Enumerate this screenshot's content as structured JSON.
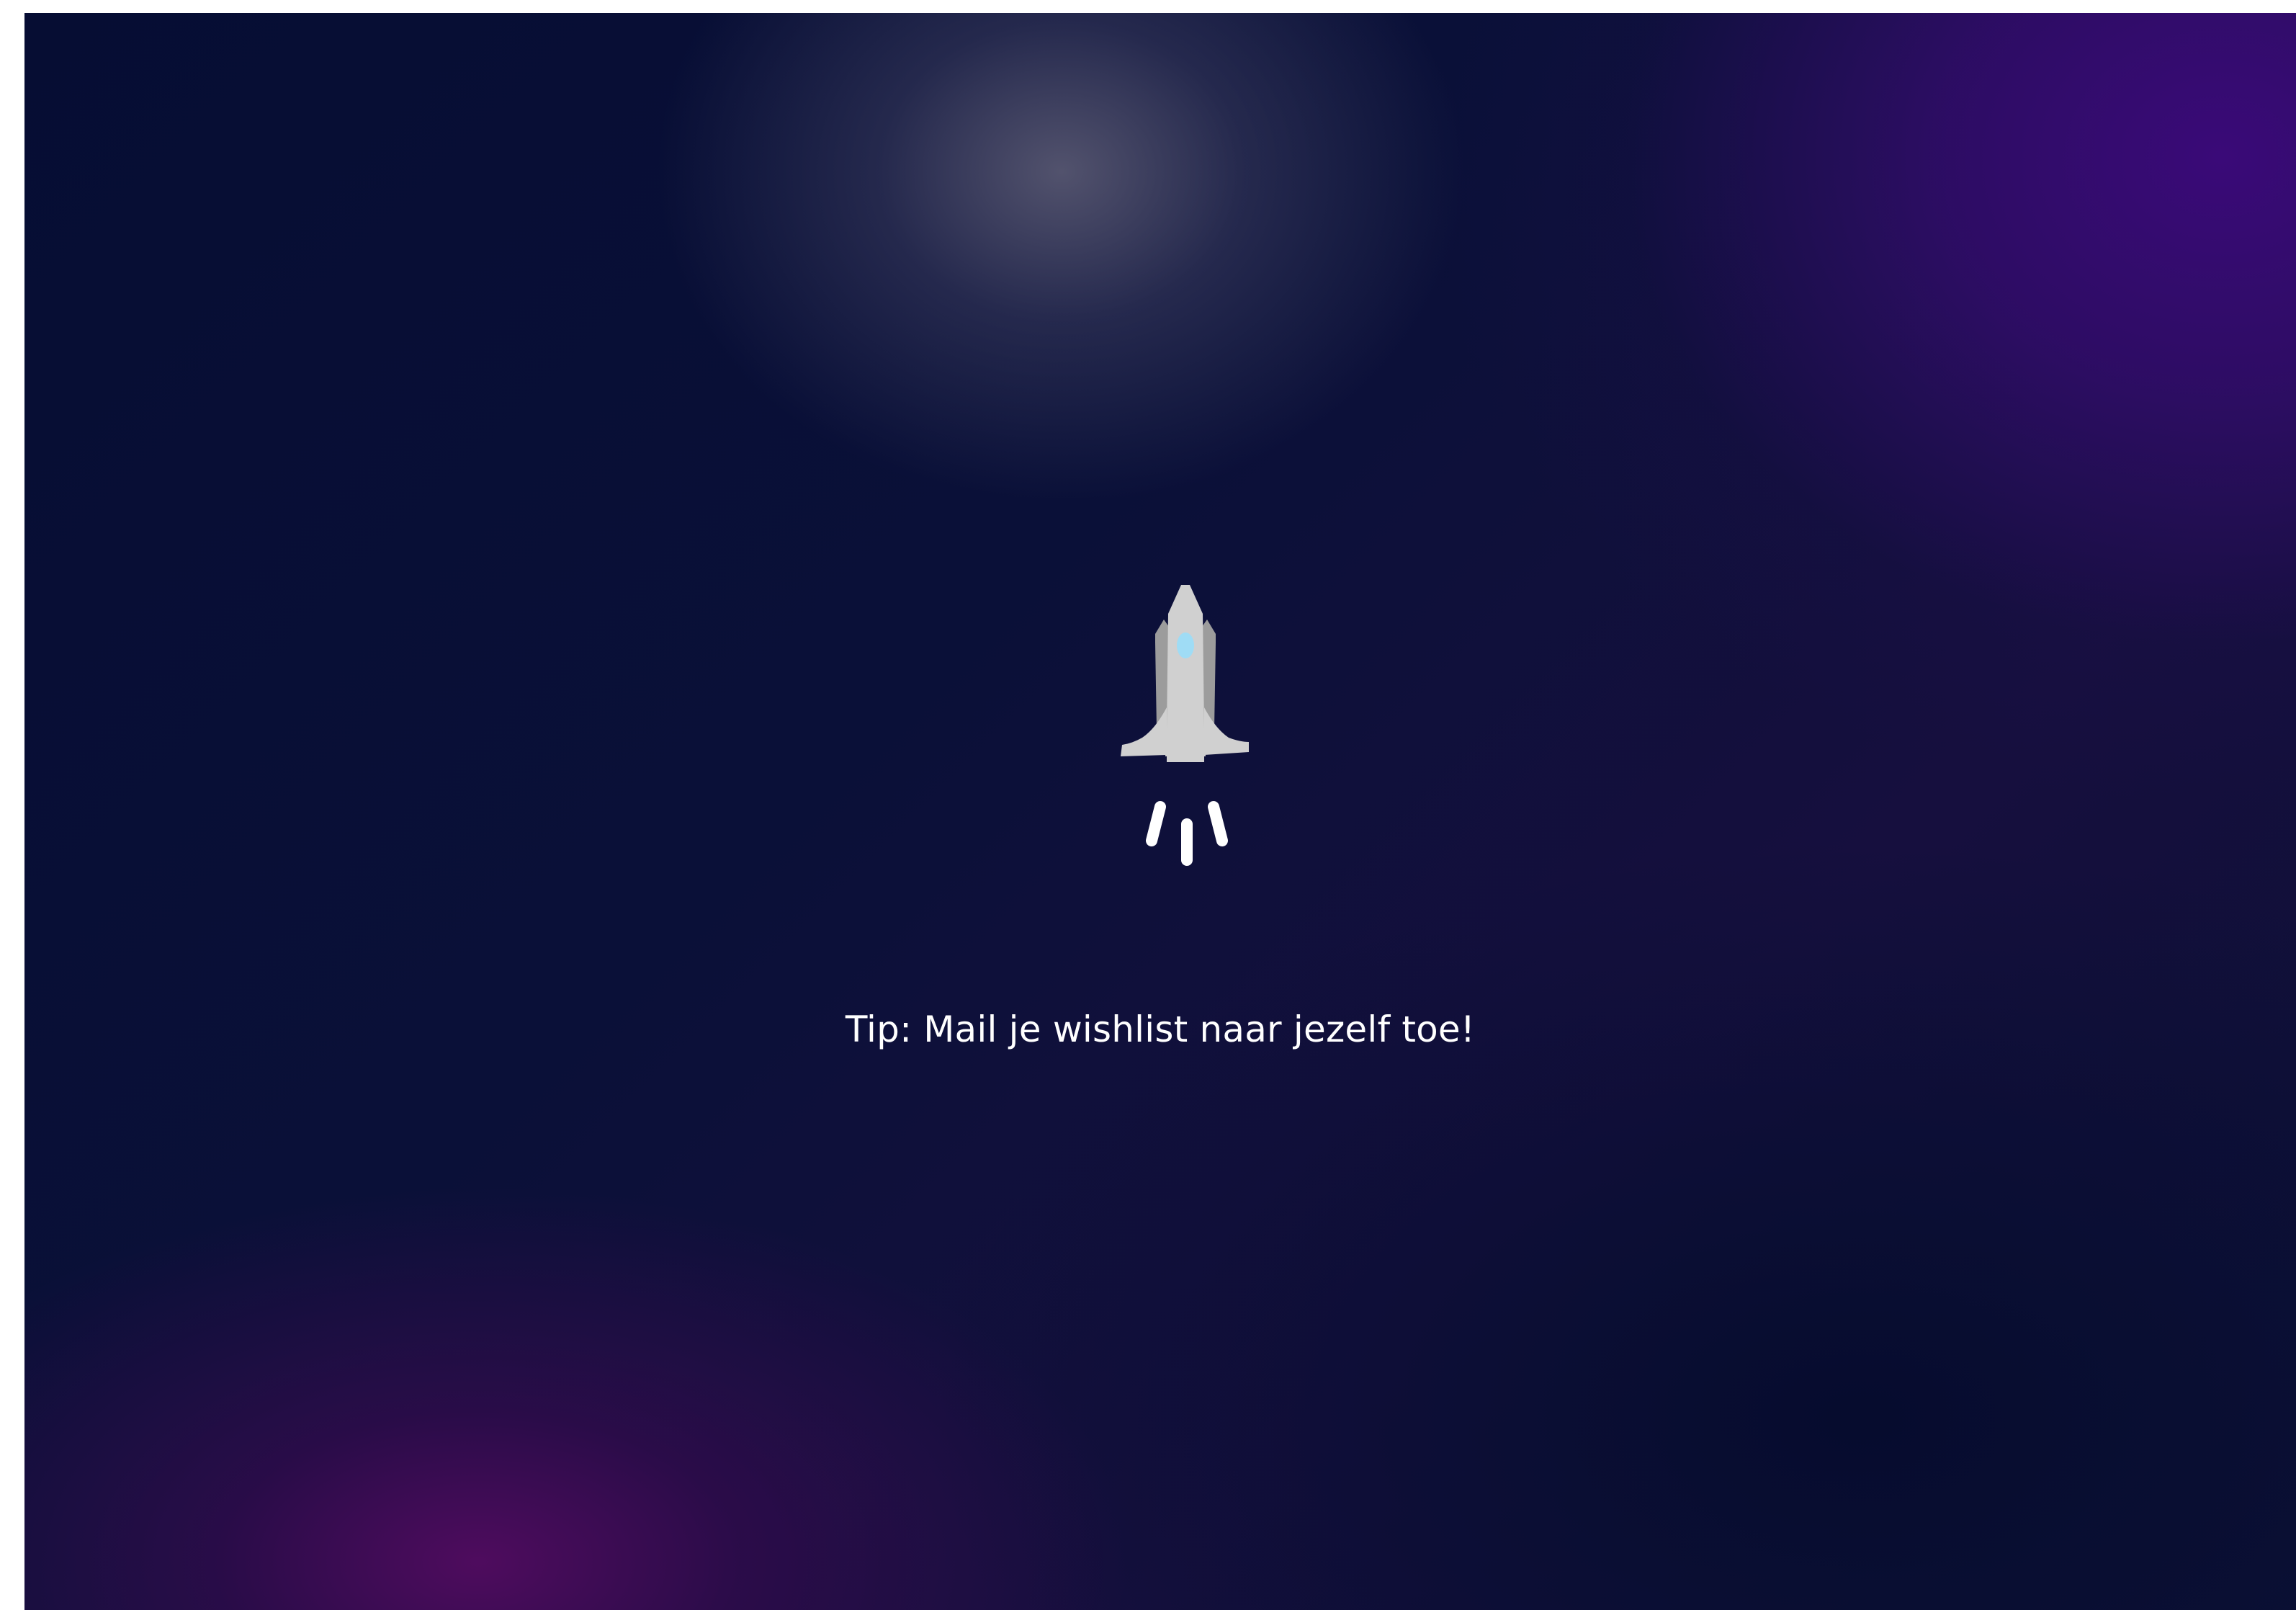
{
  "loading_screen": {
    "tip": "Tip: Mail je wishlist naar jezelf toe!",
    "icon": "rocket-icon",
    "colors": {
      "background_dark": "#060d33",
      "background_purple": "#3a0a78",
      "background_magenta": "#520c60",
      "rocket_body": "#d0d0d0",
      "rocket_shadow": "#9a9a9a",
      "rocket_window": "#9fdcf5",
      "exhaust": "#ffffff",
      "text": "#ffffff"
    }
  }
}
